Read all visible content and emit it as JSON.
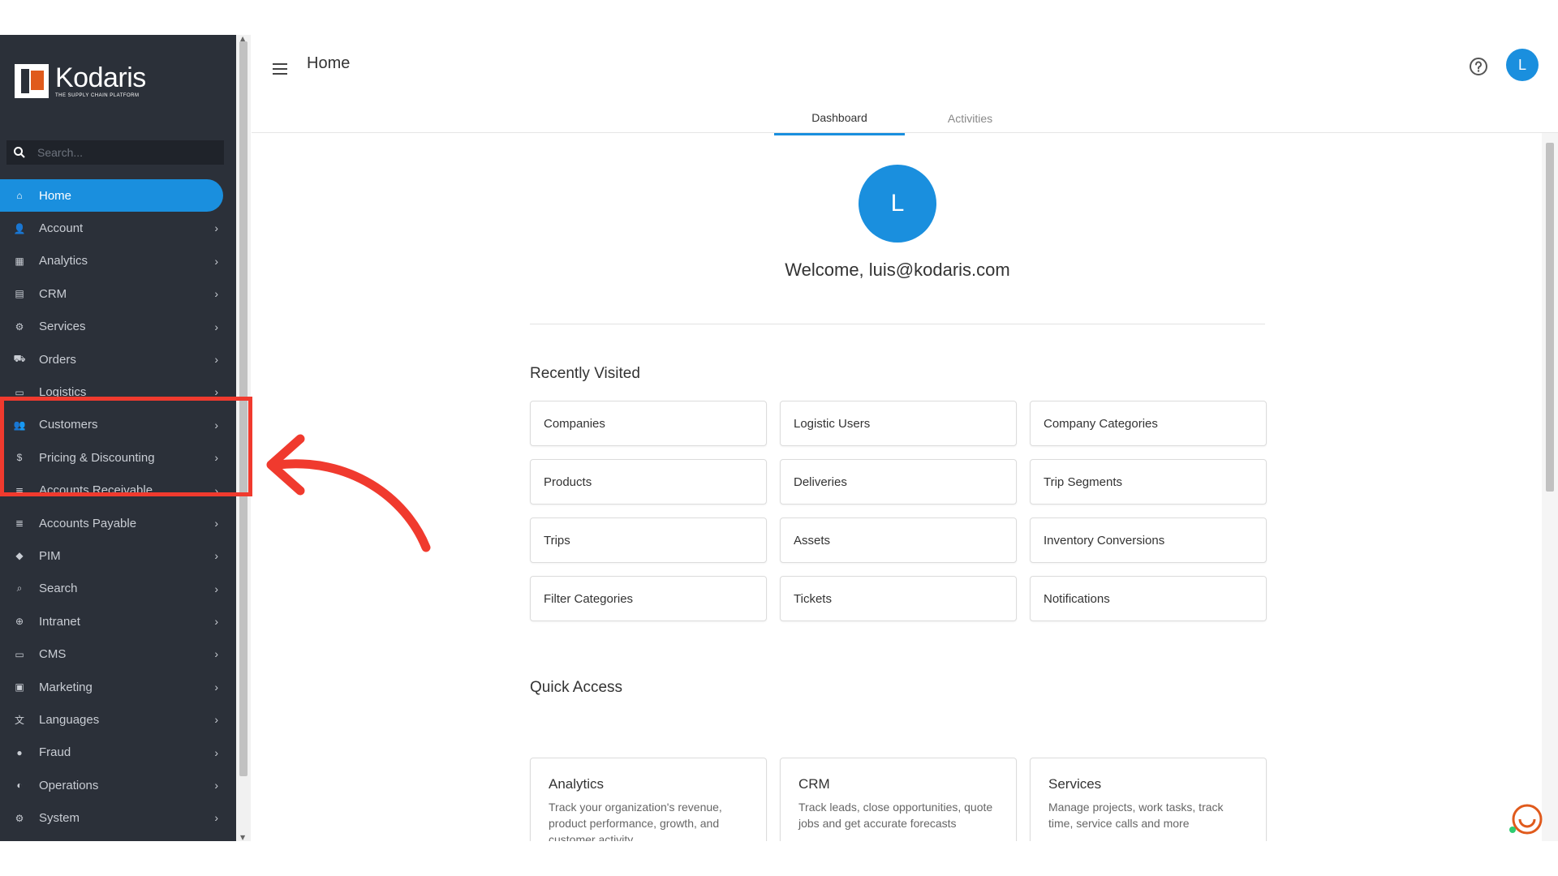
{
  "sidebar": {
    "logo_name": "Kodaris",
    "logo_tagline": "THE SUPPLY CHAIN PLATFORM",
    "search_placeholder": "Search...",
    "items": [
      {
        "label": "Home",
        "icon": "home-icon",
        "active": true,
        "chevron": false
      },
      {
        "label": "Account",
        "icon": "account-icon",
        "chevron": true
      },
      {
        "label": "Analytics",
        "icon": "analytics-icon",
        "chevron": true
      },
      {
        "label": "CRM",
        "icon": "crm-icon",
        "chevron": true
      },
      {
        "label": "Services",
        "icon": "services-icon",
        "chevron": true
      },
      {
        "label": "Orders",
        "icon": "orders-icon",
        "chevron": true
      },
      {
        "label": "Logistics",
        "icon": "logistics-icon",
        "chevron": true
      },
      {
        "label": "Customers",
        "icon": "customers-icon",
        "chevron": true
      },
      {
        "label": "Pricing & Discounting",
        "icon": "pricing-icon",
        "chevron": true
      },
      {
        "label": "Accounts Receivable",
        "icon": "accounts-receivable-icon",
        "chevron": true
      },
      {
        "label": "Accounts Payable",
        "icon": "accounts-payable-icon",
        "chevron": true
      },
      {
        "label": "PIM",
        "icon": "tag-icon",
        "chevron": true
      },
      {
        "label": "Search",
        "icon": "search-icon",
        "chevron": true
      },
      {
        "label": "Intranet",
        "icon": "intranet-icon",
        "chevron": true
      },
      {
        "label": "CMS",
        "icon": "cms-icon",
        "chevron": true
      },
      {
        "label": "Marketing",
        "icon": "marketing-icon",
        "chevron": true
      },
      {
        "label": "Languages",
        "icon": "languages-icon",
        "chevron": true
      },
      {
        "label": "Fraud",
        "icon": "fraud-icon",
        "chevron": true
      },
      {
        "label": "Operations",
        "icon": "operations-icon",
        "chevron": true
      },
      {
        "label": "System",
        "icon": "gear-icon",
        "chevron": true
      }
    ]
  },
  "header": {
    "title": "Home",
    "avatar_letter": "L"
  },
  "tabs": [
    {
      "label": "Dashboard",
      "active": true
    },
    {
      "label": "Activities",
      "active": false
    }
  ],
  "welcome": {
    "avatar_letter": "L",
    "text": "Welcome, luis@kodaris.com"
  },
  "recently_visited": {
    "title": "Recently Visited",
    "items": [
      "Companies",
      "Logistic Users",
      "Company Categories",
      "Products",
      "Deliveries",
      "Trip Segments",
      "Trips",
      "Assets",
      "Inventory Conversions",
      "Filter Categories",
      "Tickets",
      "Notifications"
    ]
  },
  "quick_access": {
    "title": "Quick Access",
    "cards": [
      {
        "title": "Analytics",
        "desc": "Track your organization's revenue, product performance, growth, and customer activity"
      },
      {
        "title": "CRM",
        "desc": "Track leads, close opportunities, quote jobs and get accurate forecasts"
      },
      {
        "title": "Services",
        "desc": "Manage projects, work tasks, track time, service calls and more"
      }
    ]
  },
  "colors": {
    "sidebar_bg": "#2b3039",
    "accent": "#1a8fde",
    "highlight": "#f03a2e",
    "brand_orange": "#e05a1c"
  }
}
